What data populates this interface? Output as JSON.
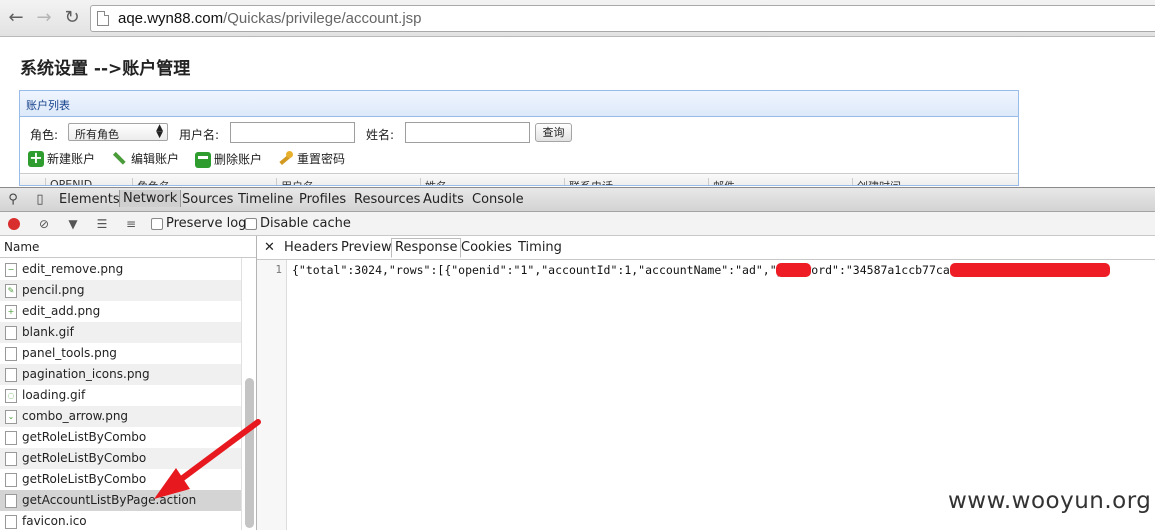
{
  "browser": {
    "url_host": "aqe.wyn88.com",
    "url_path": "/Quickas/privilege/account.jsp"
  },
  "page": {
    "title": "系统设置 -->账户管理",
    "panel_title": "账户列表",
    "filters": {
      "role_label": "角色:",
      "role_selected": "所有角色",
      "username_label": "用户名:",
      "name_label": "姓名:",
      "query_button": "查询"
    },
    "actions": [
      "新建账户",
      "编辑账户",
      "删除账户",
      "重置密码"
    ],
    "grid_columns": [
      "OPENID",
      "角色名",
      "用户名",
      "姓名",
      "联系电话",
      "邮件",
      "创建时间"
    ]
  },
  "devtools": {
    "tabs": [
      "Elements",
      "Network",
      "Sources",
      "Timeline",
      "Profiles",
      "Resources",
      "Audits",
      "Console"
    ],
    "active_tab": "Network",
    "preserve_log": "Preserve log",
    "disable_cache": "Disable cache",
    "name_header": "Name",
    "files": [
      "edit_remove.png",
      "pencil.png",
      "edit_add.png",
      "blank.gif",
      "panel_tools.png",
      "pagination_icons.png",
      "loading.gif",
      "combo_arrow.png",
      "getRoleListByCombo",
      "getRoleListByCombo",
      "getRoleListByCombo",
      "getAccountListByPage.action",
      "favicon.ico"
    ],
    "selected_file": "getAccountListByPage.action",
    "response_tabs": [
      "Headers",
      "Preview",
      "Response",
      "Cookies",
      "Timing"
    ],
    "active_response_tab": "Response",
    "line_number": "1",
    "response_text": "{\"total\":3024,\"rows\":[{\"openid\":\"1\",\"accountId\":1,\"accountName\":\"ad\",\"password\":\"34587a1ccb77ca2e05d4b71c5aa39b67d\",\""
  },
  "watermark": "www.wooyun.org",
  "colors": {
    "annotation_arrow": "#e8191e",
    "redaction": "#ee1c24",
    "panel_border": "#99bbe8"
  }
}
